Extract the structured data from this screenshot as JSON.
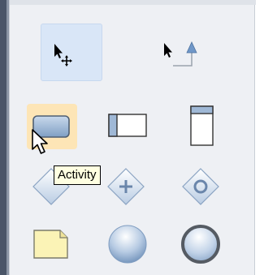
{
  "palette": {
    "tools": [
      {
        "row": 0,
        "col": 0,
        "icon": "pointer-move-icon",
        "selected": true
      },
      {
        "row": 0,
        "col": 1,
        "icon": "pointer-connector-icon",
        "selected": false
      },
      {
        "row": 1,
        "col": 0,
        "icon": "activity-icon",
        "selected": false,
        "hovered": true
      },
      {
        "row": 1,
        "col": 1,
        "icon": "swimlane-horizontal-icon",
        "selected": false
      },
      {
        "row": 1,
        "col": 2,
        "icon": "swimlane-vertical-icon",
        "selected": false
      },
      {
        "row": 2,
        "col": 0,
        "icon": "gateway-icon",
        "selected": false
      },
      {
        "row": 2,
        "col": 1,
        "icon": "parallel-gateway-icon",
        "selected": false
      },
      {
        "row": 2,
        "col": 2,
        "icon": "inclusive-gateway-icon",
        "selected": false
      },
      {
        "row": 3,
        "col": 0,
        "icon": "note-icon",
        "selected": false
      },
      {
        "row": 3,
        "col": 1,
        "icon": "start-event-icon",
        "selected": false
      },
      {
        "row": 3,
        "col": 2,
        "icon": "end-event-icon",
        "selected": false
      }
    ]
  },
  "tooltip": {
    "text": "Activity"
  },
  "colors": {
    "palette_bg": "#eef0f4",
    "selected_bg": "#d9e6f7",
    "hover_bg": "#fde5b6",
    "tooltip_bg": "#ffffe1",
    "shape_blue": "#9fb8d6",
    "shape_border": "#5d6f85"
  }
}
